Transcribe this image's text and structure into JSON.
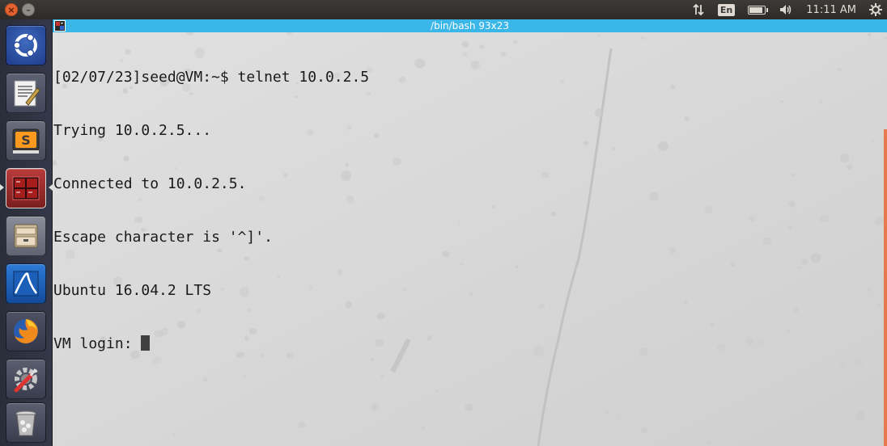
{
  "top_panel": {
    "lang": "En",
    "clock": "11:11 AM",
    "battery_level": 0.9
  },
  "launcher": {
    "items": [
      {
        "name": "ubuntu-dash",
        "icon": "ubuntu-logo-icon",
        "active": false
      },
      {
        "name": "text-editor",
        "icon": "text-editor-icon",
        "active": false
      },
      {
        "name": "sublime-text",
        "icon": "sublime-text-icon",
        "active": false
      },
      {
        "name": "terminal",
        "icon": "terminal-icon",
        "active": true
      },
      {
        "name": "files",
        "icon": "file-cabinet-icon",
        "active": false
      },
      {
        "name": "wireshark",
        "icon": "wireshark-icon",
        "active": false
      },
      {
        "name": "firefox",
        "icon": "firefox-icon",
        "active": false
      },
      {
        "name": "system-settings",
        "icon": "settings-wrench-icon",
        "active": false
      },
      {
        "name": "trash",
        "icon": "trash-icon",
        "active": false
      }
    ]
  },
  "terminal": {
    "title": "/bin/bash 93x23",
    "lines": [
      "[02/07/23]seed@VM:~$ telnet 10.0.2.5",
      "Trying 10.0.2.5...",
      "Connected to 10.0.2.5.",
      "Escape character is '^]'.",
      "Ubuntu 16.04.2 LTS",
      "VM login: "
    ]
  },
  "colors": {
    "title_bar": "#3ab6e8",
    "accent_orange": "#e57b4d",
    "terminal_bg": "#d8d8d8"
  }
}
